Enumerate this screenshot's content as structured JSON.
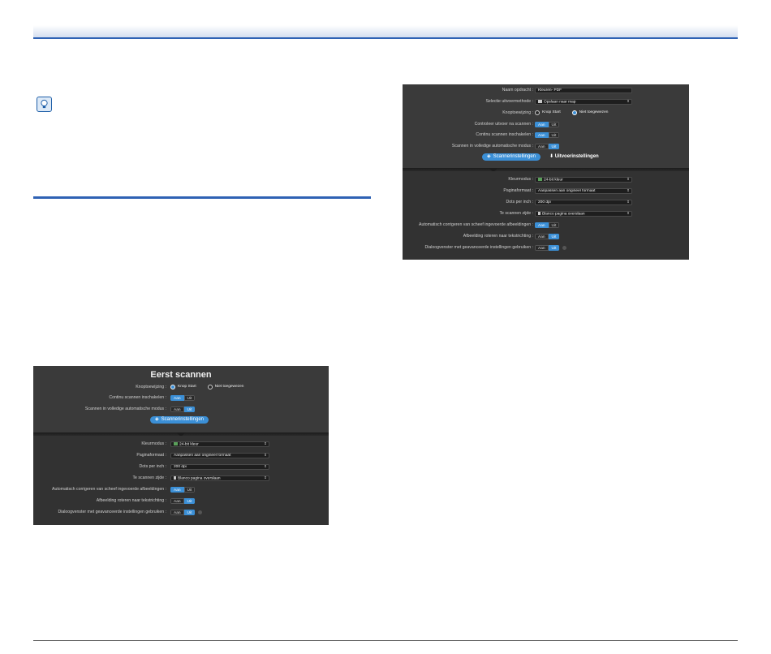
{
  "panel_left": {
    "title": "Eerst scannen",
    "button_assign": {
      "label": "Knoptoewijzing :",
      "options": [
        "Knop Start",
        "Niet toegewezen"
      ],
      "selected": "Knop Start"
    },
    "continuous_scan": {
      "label": "Continu scannen inschakelen :",
      "on": "Aan",
      "off": "Uit",
      "value": "Aan"
    },
    "full_auto": {
      "label": "Scannen in volledige automatische modus :",
      "on": "Aan",
      "off": "Uit",
      "value": "Uit"
    },
    "tab_scanner": "Scannerinstellingen",
    "color_mode": {
      "label": "Kleurmodus :",
      "value": "24-bit kleur"
    },
    "page_size": {
      "label": "Paginaformaat :",
      "value": "Aanpassen aan origineel formaat"
    },
    "dpi": {
      "label": "Dots per inch :",
      "value": "200 dpi"
    },
    "scan_side": {
      "label": "Te scannen zijde :",
      "value": "Blanco pagina overslaan"
    },
    "deskew": {
      "label": "Automatisch corrigeren van scheef ingevoerde afbeeldingen :",
      "on": "Aan",
      "off": "Uit",
      "value": "Aan"
    },
    "rotate": {
      "label": "Afbeelding roteren naar tekstrichting :",
      "on": "Aan",
      "off": "Uit",
      "value": "Uit"
    },
    "dialog": {
      "label": "Dialoogvenster met geavanceerde instellingen gebruiken :",
      "on": "Aan",
      "off": "Uit",
      "value": "Uit"
    }
  },
  "panel_right": {
    "job_name": {
      "label": "Naam opdracht :",
      "value": "Kleuren- PDF"
    },
    "output_method": {
      "label": "Selectie uitvoermethode :",
      "value": "Opslaan naar map"
    },
    "button_assign": {
      "label": "Knoptoewijzing :",
      "options": [
        "Knop Start",
        "Niet toegewezen"
      ],
      "selected": "Niet toegewezen"
    },
    "check_before": {
      "label": "Controleer uitvoer na scannen :",
      "on": "Aan",
      "off": "Uit",
      "value": "Aan"
    },
    "continuous_scan": {
      "label": "Continu scannen inschakelen :",
      "on": "Aan",
      "off": "Uit",
      "value": "Aan"
    },
    "full_auto": {
      "label": "Scannen in volledige automatische modus :",
      "on": "Aan",
      "off": "Uit",
      "value": "Uit"
    },
    "tab_scanner": "Scannerinstellingen",
    "tab_output": "Uitvoerinstellingen",
    "color_mode": {
      "label": "Kleurmodus :",
      "value": "24-bit kleur"
    },
    "page_size": {
      "label": "Paginaformaat :",
      "value": "Aanpassen aan origineel formaat"
    },
    "dpi": {
      "label": "Dots per inch :",
      "value": "200 dpi"
    },
    "scan_side": {
      "label": "Te scannen zijde :",
      "value": "Blanco pagina overslaan"
    },
    "deskew": {
      "label": "Automatisch corrigeren van scheef ingevoerde afbeeldingen :",
      "on": "Aan",
      "off": "Uit",
      "value": "Aan"
    },
    "rotate": {
      "label": "Afbeelding roteren naar tekstrichting :",
      "on": "Aan",
      "off": "Uit",
      "value": "Uit"
    },
    "dialog": {
      "label": "Dialoogvenster met geavanceerde instellingen gebruiken :",
      "on": "Aan",
      "off": "Uit",
      "value": "Uit"
    }
  },
  "colors": {
    "accent": "#3b8fd6",
    "panel": "#313131",
    "rule": "#2f62b4"
  },
  "icons": [
    "hint-lightbulb-icon",
    "scanner-tab-icon",
    "output-tab-icon",
    "color-mode-icon",
    "folder-icon",
    "page-icon",
    "radio-icon"
  ]
}
